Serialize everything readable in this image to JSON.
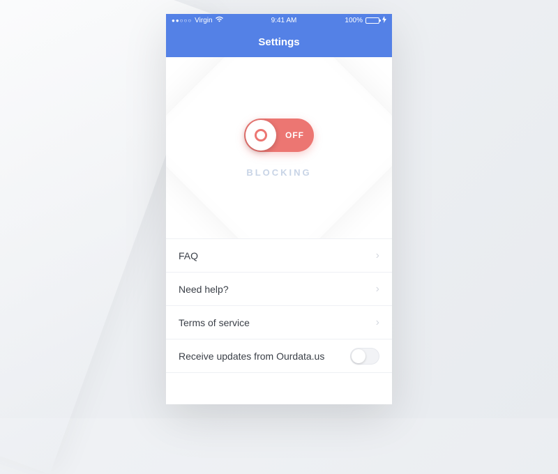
{
  "statusBar": {
    "carrier": "Virgin",
    "time": "9:41 AM",
    "battery": "100%"
  },
  "header": {
    "title": "Settings"
  },
  "hero": {
    "toggleLabel": "OFF",
    "caption": "BLOCKING"
  },
  "list": {
    "items": [
      {
        "label": "FAQ",
        "type": "chevron"
      },
      {
        "label": "Need help?",
        "type": "chevron"
      },
      {
        "label": "Terms of service",
        "type": "chevron"
      },
      {
        "label": "Receive updates from Ourdata.us",
        "type": "toggle"
      }
    ]
  }
}
